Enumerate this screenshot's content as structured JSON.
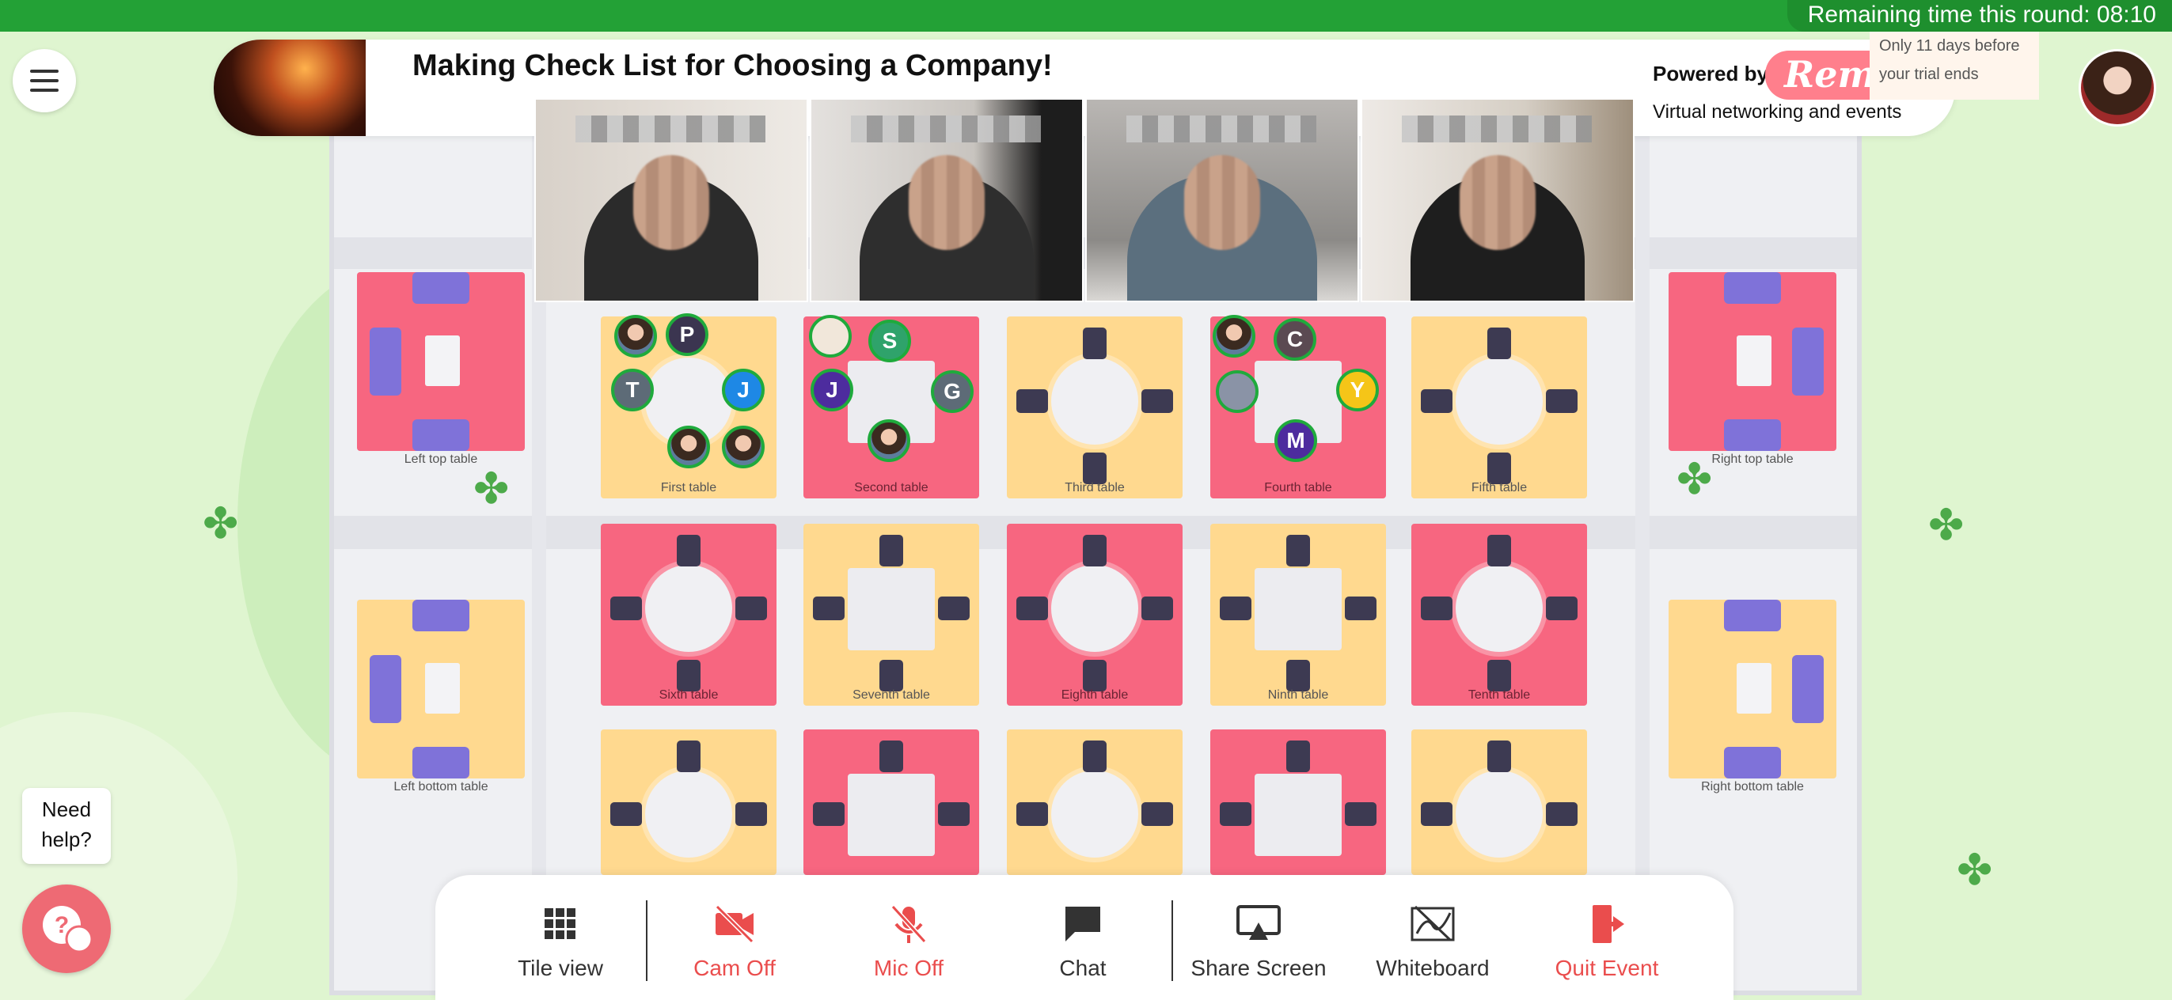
{
  "timer": {
    "text": "Remaining time this round: 08:10"
  },
  "header": {
    "title": "Making Check List for Choosing a Company!",
    "powered_by": "Powered by",
    "logo_text": "Rem",
    "tagline": "Virtual networking and events",
    "trial_notice": "Only 11 days before your trial ends"
  },
  "tables": [
    {
      "label": "Left top table"
    },
    {
      "label": "First table"
    },
    {
      "label": "Second table"
    },
    {
      "label": "Third table"
    },
    {
      "label": "Fourth table"
    },
    {
      "label": "Fifth table"
    },
    {
      "label": "Right top table"
    },
    {
      "label": "Sixth table"
    },
    {
      "label": "Seventh table"
    },
    {
      "label": "Eighth table"
    },
    {
      "label": "Ninth table"
    },
    {
      "label": "Tenth table"
    },
    {
      "label": "Left bottom table"
    },
    {
      "label": "Right bottom table"
    }
  ],
  "participants": {
    "first": [
      "P",
      "T",
      "J"
    ],
    "second": [
      "S",
      "J",
      "G"
    ],
    "fourth": [
      "C",
      "Y",
      "M"
    ]
  },
  "help": {
    "text": "Need help?"
  },
  "toolbar": {
    "tile_view": "Tile view",
    "cam_off": "Cam Off",
    "mic_off": "Mic Off",
    "chat": "Chat",
    "share_screen": "Share Screen",
    "whiteboard": "Whiteboard",
    "quit_event": "Quit Event"
  },
  "colors": {
    "accent_green": "#23a136",
    "danger_red": "#ea4d4d",
    "table_pink": "#f76680",
    "table_yellow": "#ffd98f",
    "sofa_purple": "#7f72d9"
  }
}
